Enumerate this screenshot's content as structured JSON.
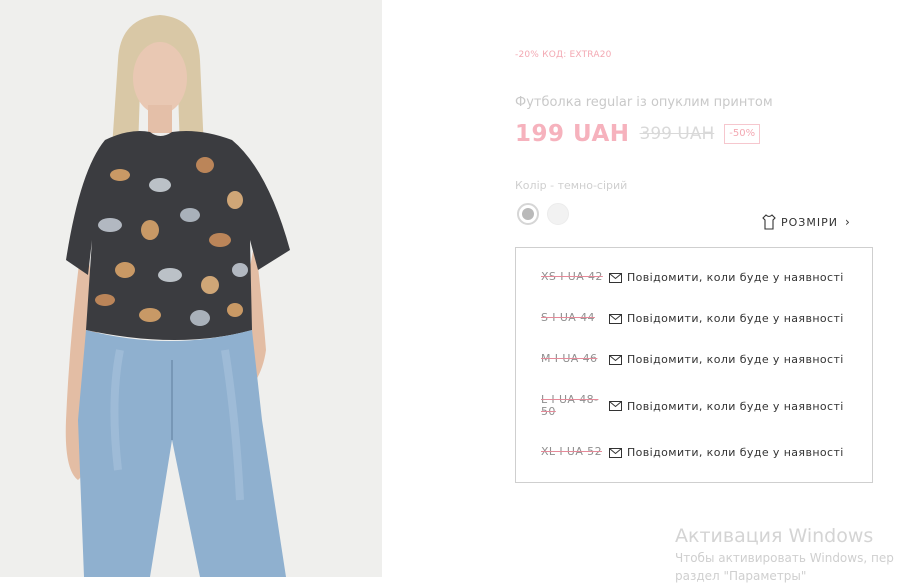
{
  "promo": "-20% КОД: EXTRA20",
  "product": {
    "title": "Футболка regular із опуклим принтом",
    "price": "199 UAH",
    "old_price": "399 UAH",
    "discount": "-50%"
  },
  "color": {
    "label": "Колір - темно-сірий"
  },
  "sizes_link": "РОЗМІРИ",
  "sizes": [
    {
      "label": "XS I UA 42",
      "notify": "Повідомити, коли буде у наявності"
    },
    {
      "label": "S I UA 44",
      "notify": "Повідомити, коли буде у наявності"
    },
    {
      "label": "M I UA 46",
      "notify": "Повідомити, коли буде у наявності"
    },
    {
      "label": "L I UA 48-50",
      "notify": "Повідомити, коли буде у наявності"
    },
    {
      "label": "XL I UA 52",
      "notify": "Повідомити, коли буде у наявності"
    }
  ],
  "windows": {
    "title": "Активация Windows",
    "line1": "Чтобы активировать Windows, пер",
    "line2": "раздел \"Параметры\""
  },
  "colors": {
    "accent_pink": "#f6b2bd",
    "text_dark": "#333333"
  }
}
